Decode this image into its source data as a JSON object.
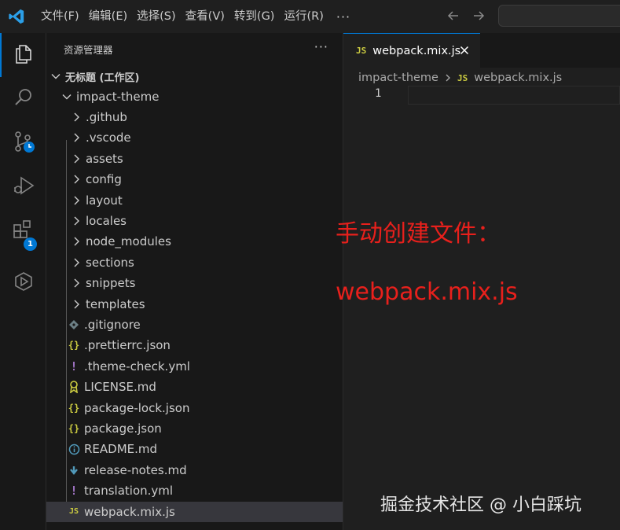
{
  "menu": {
    "items": [
      "文件(F)",
      "编辑(E)",
      "选择(S)",
      "查看(V)",
      "转到(G)",
      "运行(R)"
    ],
    "more": "···"
  },
  "activity_bar": {
    "items": [
      "files-icon",
      "search-icon",
      "source-control-icon",
      "run-debug-icon",
      "extensions-icon",
      "remote-icon"
    ],
    "extensions_badge": "1"
  },
  "sidebar": {
    "title": "资源管理器",
    "more": "···",
    "workspace": "无标题 (工作区)",
    "root_folder": "impact-theme",
    "folders": [
      ".github",
      ".vscode",
      "assets",
      "config",
      "layout",
      "locales",
      "node_modules",
      "sections",
      "snippets",
      "templates"
    ],
    "files": [
      {
        "name": ".gitignore",
        "icon": "git-icon",
        "color": "#6d8086"
      },
      {
        "name": ".prettierrc.json",
        "icon": "json-icon",
        "color": "#cbcb41"
      },
      {
        "name": ".theme-check.yml",
        "icon": "yaml-icon",
        "color": "#a074c4"
      },
      {
        "name": "LICENSE.md",
        "icon": "license-icon",
        "color": "#cbcb41"
      },
      {
        "name": "package-lock.json",
        "icon": "json-icon",
        "color": "#cbcb41"
      },
      {
        "name": "package.json",
        "icon": "json-icon",
        "color": "#cbcb41"
      },
      {
        "name": "README.md",
        "icon": "info-icon",
        "color": "#519aba"
      },
      {
        "name": "release-notes.md",
        "icon": "markdown-icon",
        "color": "#519aba"
      },
      {
        "name": "translation.yml",
        "icon": "yaml-icon",
        "color": "#a074c4"
      },
      {
        "name": "webpack.mix.js",
        "icon": "js-icon",
        "color": "#cbcb41",
        "selected": true
      }
    ]
  },
  "editor": {
    "tab_label": "webpack.mix.js",
    "tab_icon_text": "JS",
    "breadcrumb": {
      "folder": "impact-theme",
      "file": "webpack.mix.js"
    },
    "line_number": "1"
  },
  "annotations": {
    "line1": "手动创建文件：",
    "line2": "webpack.mix.js"
  },
  "watermark": "掘金技术社区 @ 小白踩坑",
  "colors": {
    "accent": "#0078d4",
    "annotation": "#e8201c",
    "js_yellow": "#cbcb41"
  }
}
